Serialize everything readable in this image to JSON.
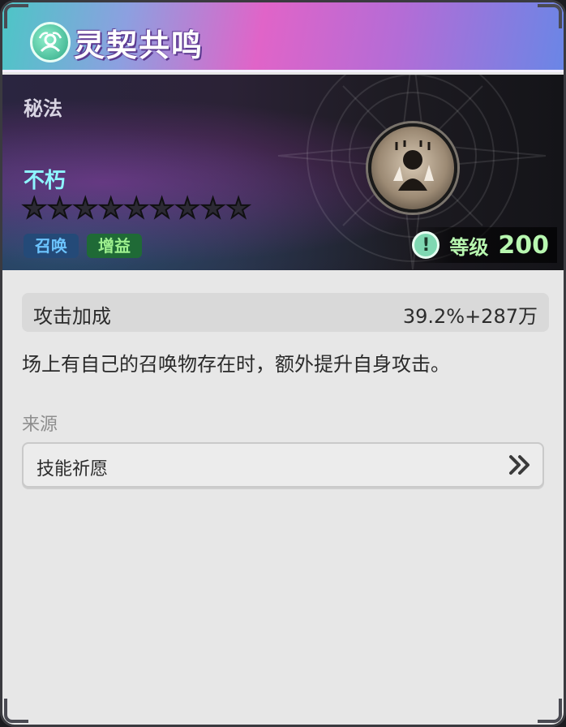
{
  "header": {
    "title": "灵契共鸣",
    "icon": "mystic-emblem-icon"
  },
  "banner": {
    "subtitle": "秘法",
    "skill_name": "不朽",
    "stars_total": 9,
    "stars_filled": 0,
    "tags": [
      "召唤",
      "增益"
    ],
    "skill_icon": "summon-figure-icon",
    "level_label": "等级",
    "level_value": "200"
  },
  "stat": {
    "name": "攻击加成",
    "value": "39.2%+287万"
  },
  "description": "场上有自己的召唤物存在时，额外提升自身攻击。",
  "source": {
    "title": "来源",
    "item_label": "技能祈愿"
  },
  "colors": {
    "summon_tag": "#6cc4ff",
    "buff_tag": "#9ef08e",
    "level": "#b8f7b0",
    "skill_name": "#8ef6ff"
  }
}
